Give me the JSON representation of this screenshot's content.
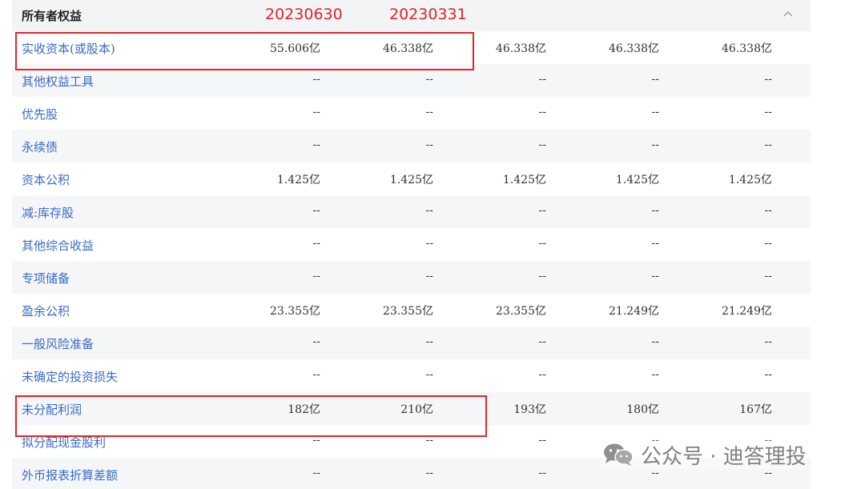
{
  "section": {
    "title": "所有者权益"
  },
  "annotations": {
    "date_1": "20230630",
    "date_2": "20230331",
    "highlight_color": "#e0252a"
  },
  "rows": [
    {
      "label": "实收资本(或股本)",
      "values": [
        "55.606亿",
        "46.338亿",
        "46.338亿",
        "46.338亿",
        "46.338亿"
      ]
    },
    {
      "label": "其他权益工具",
      "values": [
        "--",
        "--",
        "--",
        "--",
        "--"
      ]
    },
    {
      "label": "优先股",
      "values": [
        "--",
        "--",
        "--",
        "--",
        "--"
      ]
    },
    {
      "label": "永续债",
      "values": [
        "--",
        "--",
        "--",
        "--",
        "--"
      ]
    },
    {
      "label": "资本公积",
      "values": [
        "1.425亿",
        "1.425亿",
        "1.425亿",
        "1.425亿",
        "1.425亿"
      ]
    },
    {
      "label": "减:库存股",
      "values": [
        "--",
        "--",
        "--",
        "--",
        "--"
      ]
    },
    {
      "label": "其他综合收益",
      "values": [
        "--",
        "--",
        "--",
        "--",
        "--"
      ]
    },
    {
      "label": "专项储备",
      "values": [
        "--",
        "--",
        "--",
        "--",
        "--"
      ]
    },
    {
      "label": "盈余公积",
      "values": [
        "23.355亿",
        "23.355亿",
        "23.355亿",
        "21.249亿",
        "21.249亿"
      ]
    },
    {
      "label": "一般风险准备",
      "values": [
        "--",
        "--",
        "--",
        "--",
        "--"
      ]
    },
    {
      "label": "未确定的投资损失",
      "values": [
        "--",
        "--",
        "--",
        "--",
        "--"
      ]
    },
    {
      "label": "未分配利润",
      "values": [
        "182亿",
        "210亿",
        "193亿",
        "180亿",
        "167亿"
      ]
    },
    {
      "label": "拟分配现金股利",
      "values": [
        "--",
        "--",
        "--",
        "--",
        "--"
      ]
    },
    {
      "label": "外币报表折算差额",
      "values": [
        "--",
        "--",
        "--",
        "--",
        "--"
      ]
    }
  ],
  "watermark": {
    "text": "公众号 · 迪答理投",
    "icon": "wechat-icon"
  },
  "colors": {
    "label_blue": "#3b6ac9",
    "stripe": "#f5f6f8",
    "annotation_red": "#e0252a"
  }
}
